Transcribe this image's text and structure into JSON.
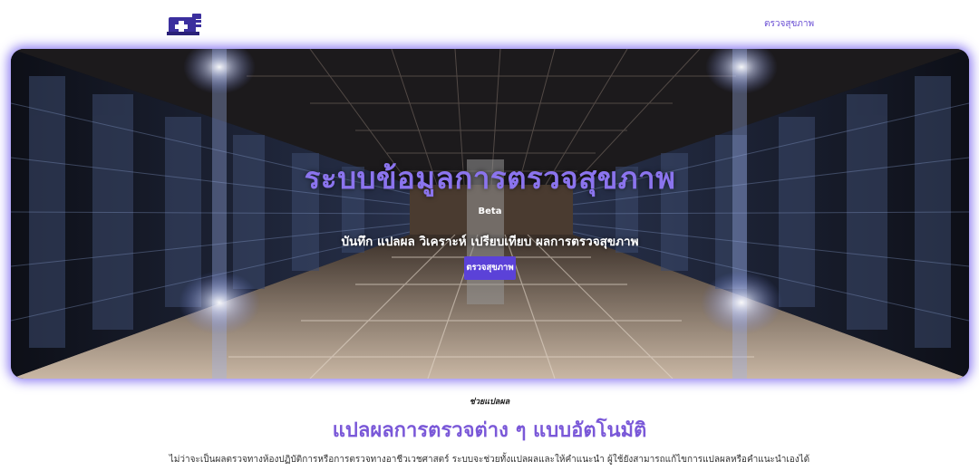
{
  "header": {
    "logo_icon": "medical-kit-icon",
    "nav_link": "ตรวจสุขภาพ"
  },
  "hero": {
    "title": "ระบบข้อมูลการตรวจสุขภาพ",
    "badge": "Beta",
    "subtitle": "บันทึก แปลผล วิเคราะห์ เปรียบเทียบ ผลการตรวจสุขภาพ",
    "button_label": "ตรวจสุขภาพ",
    "background": "server-room-corridor-image"
  },
  "intro": {
    "eyebrow": "ช่วยแปลผล",
    "title": "แปลผลการตรวจต่าง ๆ แบบอัตโนมัติ",
    "body": "ไม่ว่าจะเป็นผลตรวจทางห้องปฏิบัติการหรือการตรวจทางอาชีวเวชศาสตร์ ระบบจะช่วยทั้งแปลผลและให้คำแนะนำ ผู้ใช้ยังสามารถแก้ไขการแปลผลหรือคำแนะนำเองได้"
  },
  "colors": {
    "accent": "#5b42d8",
    "title_purple": "#8b74ee",
    "glow": "#7864f0"
  }
}
